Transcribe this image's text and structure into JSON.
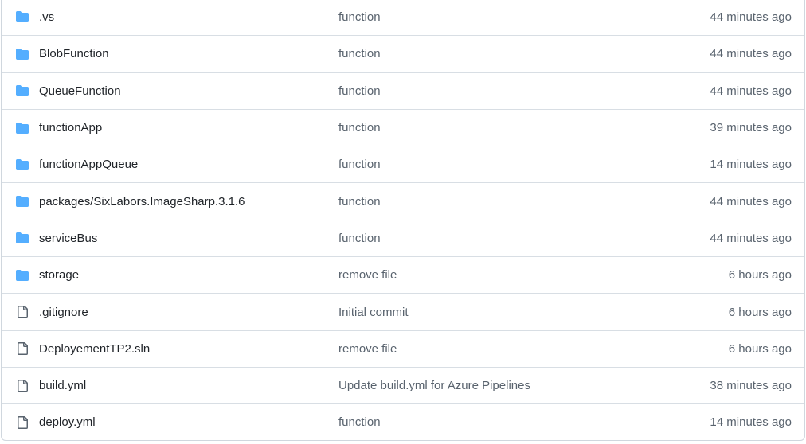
{
  "colors": {
    "folder_icon": "#54aeff",
    "file_icon": "#59636e",
    "text_primary": "#1f2328",
    "text_secondary": "#59636e",
    "border": "#d8dee4"
  },
  "files": [
    {
      "type": "folder",
      "icon": "folder-icon",
      "name": ".vs",
      "message": "function",
      "age": "44 minutes ago"
    },
    {
      "type": "folder",
      "icon": "folder-icon",
      "name": "BlobFunction",
      "message": "function",
      "age": "44 minutes ago"
    },
    {
      "type": "folder",
      "icon": "folder-icon",
      "name": "QueueFunction",
      "message": "function",
      "age": "44 minutes ago"
    },
    {
      "type": "folder",
      "icon": "folder-icon",
      "name": "functionApp",
      "message": "function",
      "age": "39 minutes ago"
    },
    {
      "type": "folder",
      "icon": "folder-icon",
      "name": "functionAppQueue",
      "message": "function",
      "age": "14 minutes ago"
    },
    {
      "type": "folder",
      "icon": "folder-icon",
      "name": "packages/SixLabors.ImageSharp.3.1.6",
      "message": "function",
      "age": "44 minutes ago"
    },
    {
      "type": "folder",
      "icon": "folder-icon",
      "name": "serviceBus",
      "message": "function",
      "age": "44 minutes ago"
    },
    {
      "type": "folder",
      "icon": "folder-icon",
      "name": "storage",
      "message": "remove file",
      "age": "6 hours ago"
    },
    {
      "type": "file",
      "icon": "file-icon",
      "name": ".gitignore",
      "message": "Initial commit",
      "age": "6 hours ago"
    },
    {
      "type": "file",
      "icon": "file-icon",
      "name": "DeployementTP2.sln",
      "message": "remove file",
      "age": "6 hours ago"
    },
    {
      "type": "file",
      "icon": "file-icon",
      "name": "build.yml",
      "message": "Update build.yml for Azure Pipelines",
      "age": "38 minutes ago"
    },
    {
      "type": "file",
      "icon": "file-icon",
      "name": "deploy.yml",
      "message": "function",
      "age": "14 minutes ago"
    }
  ]
}
